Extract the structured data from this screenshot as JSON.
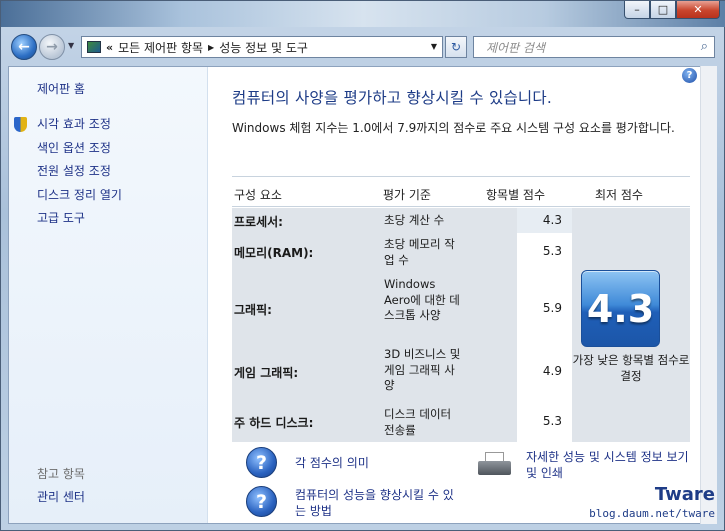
{
  "window": {
    "caption_min": "–",
    "caption_max": "□",
    "caption_close": "✕"
  },
  "nav": {
    "back_icon": "back-arrow-icon",
    "forward_icon": "forward-arrow-icon",
    "address_chevron": "«",
    "breadcrumb": [
      "모든 제어판 항목",
      "성능 정보 및 도구"
    ],
    "search_placeholder": "제어판 검색"
  },
  "sidebar": {
    "home": "제어판 홈",
    "items": [
      {
        "label": "시각 효과 조정",
        "icon": "shield-icon"
      },
      {
        "label": "색인 옵션 조정"
      },
      {
        "label": "전원 설정 조정"
      },
      {
        "label": "디스크 정리 열기"
      },
      {
        "label": "고급 도구"
      }
    ],
    "see_also_heading": "참고 항목",
    "see_also_items": [
      "관리 센터"
    ]
  },
  "main": {
    "title": "컴퓨터의 사양을 평가하고 향상시킬 수 있습니다.",
    "description": "Windows 체험 지수는 1.0에서 7.9까지의 점수로 주요 시스템 구성 요소를 평가합니다.",
    "table": {
      "headers": [
        "구성 요소",
        "평가 기준",
        "항목별 점수",
        "최저 점수"
      ],
      "rows": [
        {
          "component": "프로세서:",
          "criteria": "초당 계산 수",
          "score": "4.3"
        },
        {
          "component": "메모리(RAM):",
          "criteria": "초당 메모리 작업 수",
          "score": "5.3"
        },
        {
          "component": "그래픽:",
          "criteria": "Windows Aero에 대한 데스크톱 사양",
          "score": "5.9"
        },
        {
          "component": "게임 그래픽:",
          "criteria": "3D 비즈니스 및 게임 그래픽 사양",
          "score": "4.9"
        },
        {
          "component": "주 하드 디스크:",
          "criteria": "디스크 데이터 전송률",
          "score": "5.3"
        }
      ],
      "base_score": "4.3",
      "base_caption": "가장 낮은 항목별 점수로 결정"
    },
    "links": {
      "score_meaning": "각 점수의 의미",
      "improve": "컴퓨터의 성능을 향상시킬 수 있는 방법",
      "print_details": "자세한 성능 및 시스템 정보 보기 및 인쇄"
    }
  },
  "watermark": {
    "brand": "Tware",
    "url": "blog.daum.net/tware"
  },
  "colors": {
    "link": "#1e3287",
    "title": "#1e3c87",
    "table_gray": "#dfe4ea",
    "badge_blue": "#2f74c9"
  }
}
